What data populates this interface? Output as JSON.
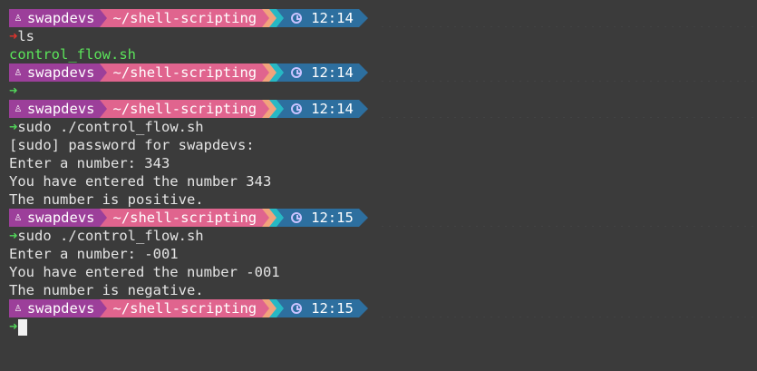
{
  "prompt": {
    "user": "swapdevs",
    "path": "~/shell-scripting",
    "icon_user": "linux-tux-icon",
    "icon_time": "clock-icon",
    "colors": {
      "user": "#9c3f9a",
      "path": "#e0648e",
      "peach": "#f2a37c",
      "cyan": "#27b8c4",
      "time": "#2d6f9f",
      "bg": "#3b3b3b"
    }
  },
  "blocks": [
    {
      "time": "12:14",
      "status": "error",
      "command": "ls",
      "output": [
        "control_flow.sh"
      ]
    },
    {
      "time": "12:14",
      "status": "ok",
      "command": "",
      "output": []
    },
    {
      "time": "12:14",
      "status": "ok",
      "command": "sudo ./control_flow.sh",
      "output": [
        "[sudo] password for swapdevs:",
        "Enter a number: 343",
        "You have entered the number 343",
        "The number is positive."
      ]
    },
    {
      "time": "12:15",
      "status": "ok",
      "command": "sudo ./control_flow.sh",
      "output": [
        "Enter a number: -001",
        "You have entered the number -001",
        "The number is negative."
      ]
    },
    {
      "time": "12:15",
      "status": "ok",
      "command": "",
      "output": []
    }
  ],
  "glyphs": {
    "arrow": "➜",
    "linux": "♙"
  }
}
